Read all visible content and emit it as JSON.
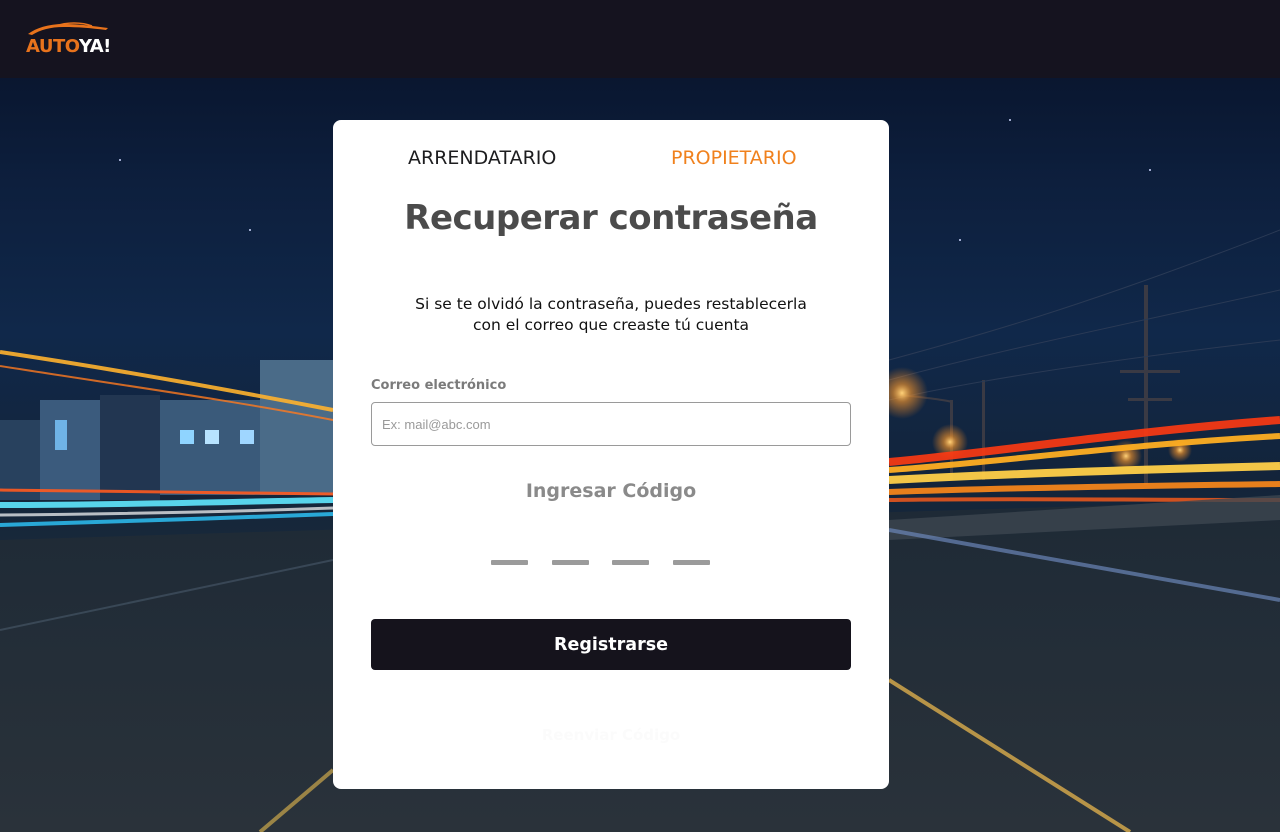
{
  "header": {
    "logo": {
      "part1": "AUTO",
      "part2": "YA!"
    }
  },
  "tabs": [
    {
      "label": "ARRENDATARIO",
      "active": false
    },
    {
      "label": "PROPIETARIO",
      "active": true
    }
  ],
  "form": {
    "title": "Recuperar contraseña",
    "description_line1": "Si se te olvidó la contraseña, puedes restablecerla",
    "description_line2": "con el correo que creaste tú cuenta",
    "email": {
      "label": "Correo electrónico",
      "placeholder": "Ex: mail@abc.com",
      "value": ""
    },
    "code": {
      "heading": "Ingresar Código",
      "digits": [
        "",
        "",
        "",
        ""
      ]
    },
    "submit_label": "Registrarse",
    "resend_label": "Reenviar Código"
  },
  "colors": {
    "accent": "#f0811d",
    "logo_orange": "#e8731c",
    "header_bg": "#15131f",
    "button_bg": "#15131c",
    "title_gray": "#4b4b4b",
    "muted_gray": "#8a8a8a"
  }
}
